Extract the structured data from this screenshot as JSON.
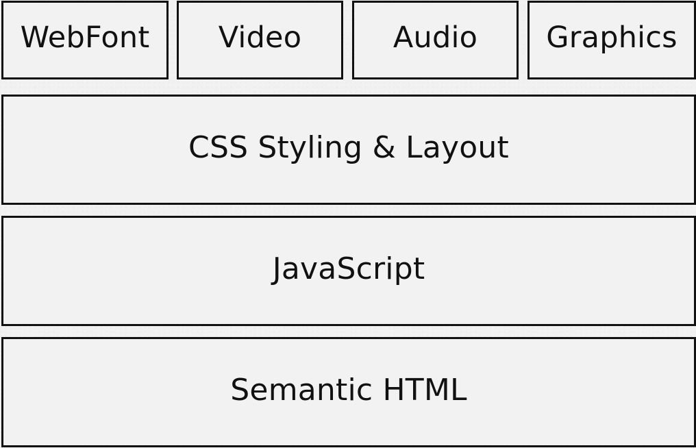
{
  "diagram": {
    "top_row": [
      {
        "label": "WebFont"
      },
      {
        "label": "Video"
      },
      {
        "label": "Audio"
      },
      {
        "label": "Graphics"
      }
    ],
    "layers": [
      {
        "label": "CSS Styling & Layout"
      },
      {
        "label": "JavaScript"
      },
      {
        "label": "Semantic HTML"
      }
    ]
  }
}
